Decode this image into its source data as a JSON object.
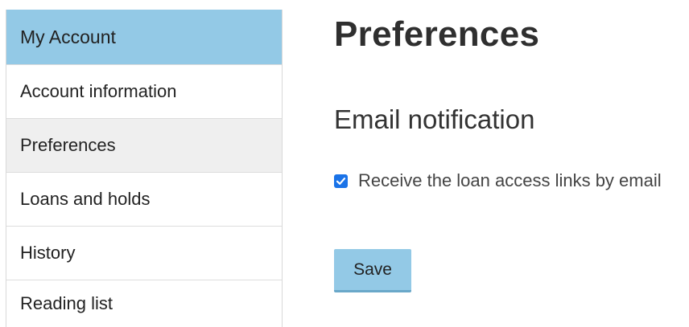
{
  "sidebar": {
    "header": "My Account",
    "items": [
      {
        "label": "Account information",
        "active": false
      },
      {
        "label": "Preferences",
        "active": true
      },
      {
        "label": "Loans and holds",
        "active": false
      },
      {
        "label": "History",
        "active": false
      },
      {
        "label": "Reading list",
        "active": false
      }
    ]
  },
  "main": {
    "title": "Preferences",
    "section_title": "Email notification",
    "checkbox": {
      "label": "Receive the loan access links by email",
      "checked": true,
      "icon": "checkmark-icon"
    },
    "save_label": "Save"
  },
  "colors": {
    "accent": "#93c9e6",
    "active_item_bg": "#efefef",
    "checkbox_fill": "#1a73e8"
  }
}
